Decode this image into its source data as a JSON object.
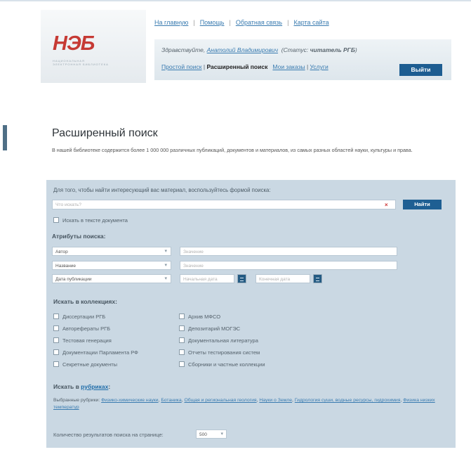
{
  "logo": {
    "text_main": "НЭ",
    "text_accent": "Б",
    "subtitle": "НАЦИОНАЛЬНАЯ ЭЛЕКТРОННАЯ БИБЛИОТЕКА"
  },
  "top_nav": [
    "На главную",
    "Помощь",
    "Обратная связь",
    "Карта сайта"
  ],
  "user": {
    "greeting": "Здравствуйте,",
    "name": "Анатолий Владимирович",
    "status_prefix": "(Статус: ",
    "status": "читатель РГБ",
    "status_suffix": ")"
  },
  "search_nav": {
    "simple": "Простой поиск",
    "advanced": "Расширенный поиск",
    "orders": "Мои заказы",
    "services": "Услуги",
    "logout": "Выйти"
  },
  "page": {
    "title": "Расширенный поиск",
    "intro": "В нашей библиотеке содержится более 1 000 000 различных публикаций, документов и материалов, из самых разных областей науки, культуры и права."
  },
  "search": {
    "hint": "Для того, чтобы найти интересующий вас материал, воспользуйтесь формой поиска:",
    "placeholder": "Что искать?",
    "clear_icon": "close-icon",
    "button": "Найти",
    "full_text_label": "Искать в тексте документа"
  },
  "attributes": {
    "title": "Атрибуты поиска:",
    "rows": [
      {
        "select": "Автор",
        "placeholder": "Значение"
      },
      {
        "select": "Название",
        "placeholder": "Значение"
      },
      {
        "select": "Дата публикации",
        "start": "Начальная дата",
        "end": "Конечная дата"
      }
    ]
  },
  "collections": {
    "title": "Искать в коллекциях:",
    "left": [
      "Диссертации РГБ",
      "Авторефераты РГБ",
      "Тестовая генерация",
      "Документации Парламента РФ",
      "Секретные документы"
    ],
    "right": [
      "Архив МФСО",
      "Депозитарий МОГЭС",
      "Документальная литература",
      "Отчеты тестирования систем",
      "Сборники и частные коллекции"
    ]
  },
  "rubrics": {
    "title_prefix": "Искать в ",
    "title_link": "рубриках",
    "selected_label": "Выбранные рубрики:",
    "items": [
      "Физико-химические науки",
      "Ботаника",
      "Общая и региональная геология",
      "Науки о Земле",
      "Гидрология суши, водные ресурсы, гидрохимия",
      "Физика низких температур"
    ]
  },
  "results": {
    "label": "Количество результатов поиска на странице:",
    "value": "500"
  }
}
